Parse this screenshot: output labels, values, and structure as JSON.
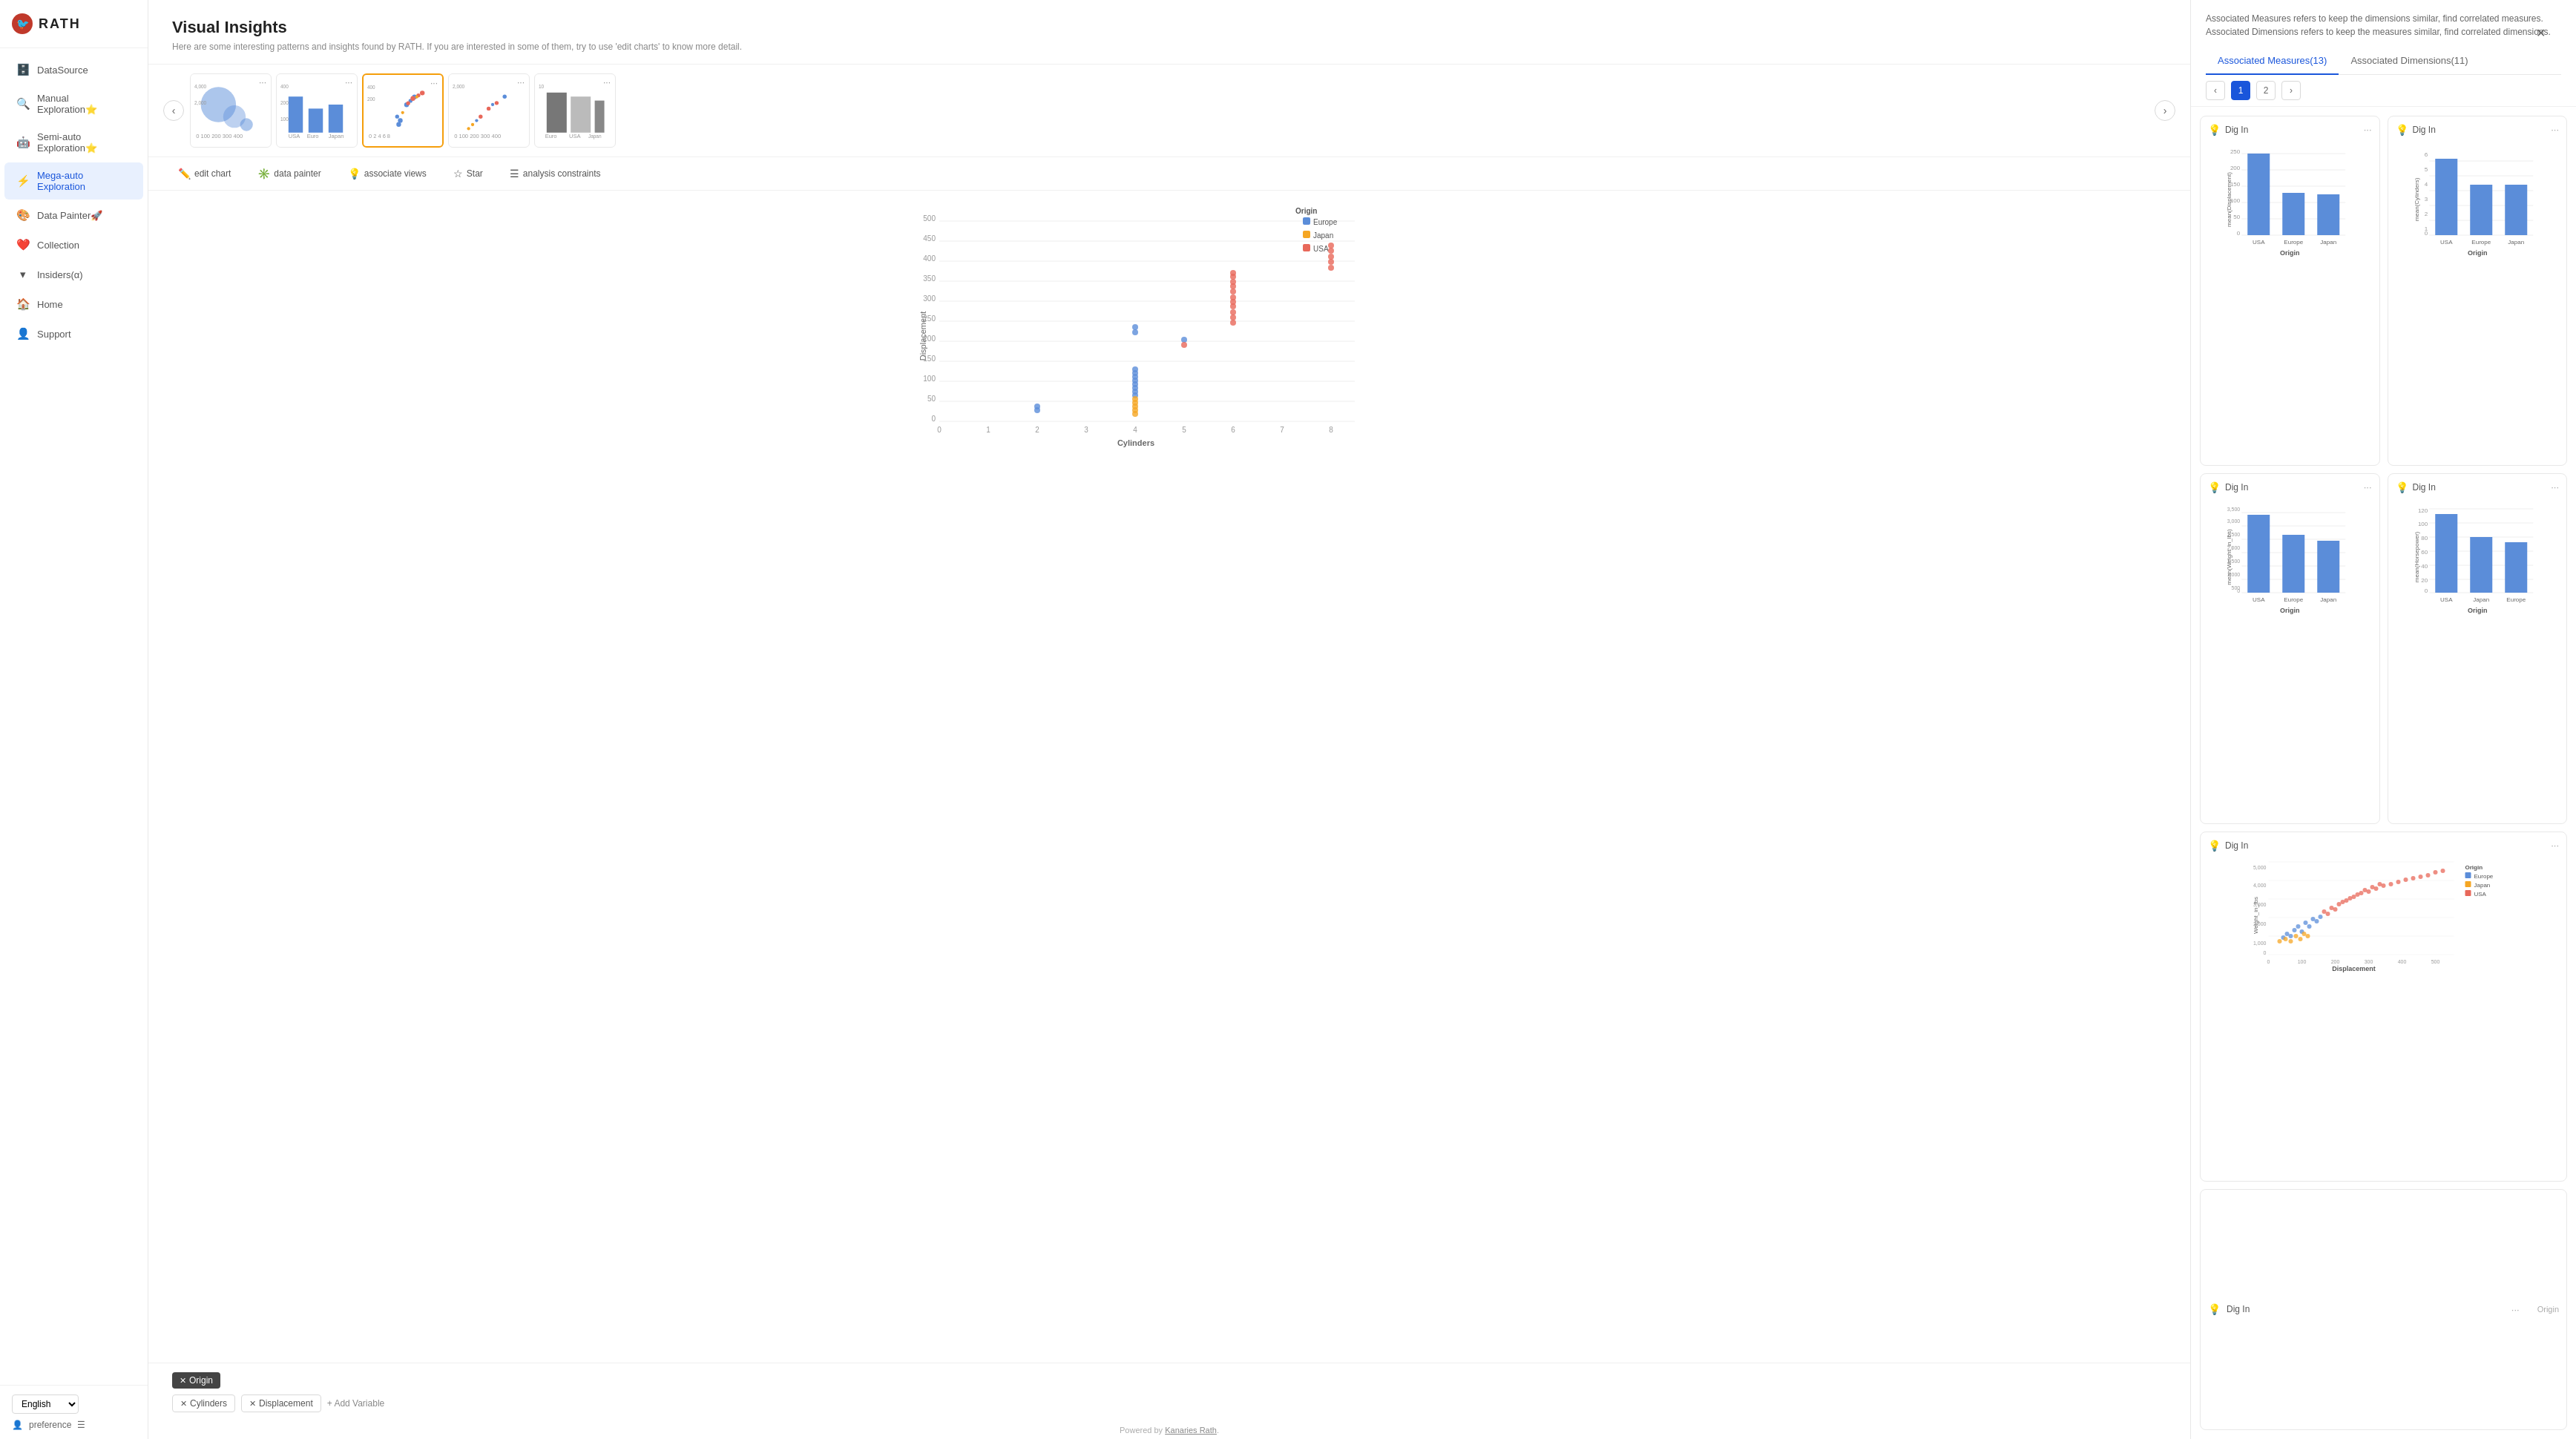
{
  "app": {
    "name": "RATH",
    "logo_emoji": "🐦"
  },
  "sidebar": {
    "items": [
      {
        "id": "datasource",
        "label": "DataSource",
        "icon": "🗄️",
        "active": false
      },
      {
        "id": "manual",
        "label": "Manual Exploration⭐",
        "icon": "🔍",
        "active": false
      },
      {
        "id": "semiauto",
        "label": "Semi-auto Exploration⭐",
        "icon": "🤖",
        "active": false
      },
      {
        "id": "megaauto",
        "label": "Mega-auto Exploration",
        "icon": "⚡",
        "active": true
      },
      {
        "id": "datapainter",
        "label": "Data Painter🚀",
        "icon": "🎨",
        "active": false
      },
      {
        "id": "collection",
        "label": "Collection",
        "icon": "❤️",
        "active": false
      },
      {
        "id": "insiders",
        "label": "Insiders(α)",
        "icon": "▾",
        "active": false
      },
      {
        "id": "home",
        "label": "Home",
        "icon": "🏠",
        "active": false
      },
      {
        "id": "support",
        "label": "Support",
        "icon": "👤",
        "active": false
      }
    ],
    "bottom": {
      "language": "English",
      "preference_label": "preference"
    }
  },
  "main": {
    "title": "Visual Insights",
    "subtitle": "Here are some interesting patterns and insights found by RATH. If you are interested in some of them, try to use 'edit charts' to know more detail.",
    "toolbar": {
      "edit_chart": "edit chart",
      "data_painter": "data painter",
      "associate_views": "associate views",
      "star": "Star",
      "analysis_constraints": "analysis constraints"
    },
    "chart": {
      "x_label": "Cylinders",
      "y_label": "Displacement",
      "legend_title": "Origin",
      "legend_items": [
        "Europe",
        "Japan",
        "USA"
      ],
      "x_ticks": [
        "0",
        "1",
        "2",
        "3",
        "4",
        "5",
        "6",
        "7",
        "8"
      ],
      "y_ticks": [
        "0",
        "50",
        "100",
        "150",
        "200",
        "250",
        "300",
        "350",
        "400",
        "450",
        "500"
      ]
    },
    "variables": {
      "row1": [
        {
          "label": "Origin",
          "removable": true
        }
      ],
      "row2": [
        {
          "label": "Cylinders",
          "removable": true
        },
        {
          "label": "Displacement",
          "removable": true
        }
      ],
      "add_variable": "+ Add Variable"
    },
    "footer": {
      "text": "Powered by ",
      "link_text": "Kanaries Rath",
      "link_url": "#"
    }
  },
  "right_panel": {
    "description": "Associated Measures refers to keep the dimensions similar, find correlated measures. Associated Dimensions refers to keep the measures similar, find correlated dimensions.",
    "tabs": [
      {
        "label": "Associated Measures(13)",
        "active": true
      },
      {
        "label": "Associated Dimensions(11)",
        "active": false
      }
    ],
    "pagination": {
      "current": 1,
      "total": 2
    },
    "cards": [
      {
        "id": 1,
        "label": "Dig In",
        "type": "bar",
        "x_axis": "Origin",
        "y_axis": "mean(Displacement)",
        "data": [
          {
            "label": "USA",
            "value": 250
          },
          {
            "label": "Europe",
            "value": 105
          },
          {
            "label": "Japan",
            "value": 100
          }
        ],
        "y_max": 250,
        "y_ticks": [
          "0",
          "50",
          "100",
          "150",
          "200",
          "250"
        ]
      },
      {
        "id": 2,
        "label": "Dig In",
        "type": "bar",
        "x_axis": "Origin",
        "y_axis": "mean(Cylinders)",
        "data": [
          {
            "label": "USA",
            "value": 6.2
          },
          {
            "label": "Europe",
            "value": 4
          },
          {
            "label": "Japan",
            "value": 4
          }
        ],
        "y_max": 7,
        "y_ticks": [
          "0",
          "1",
          "2",
          "3",
          "4",
          "5",
          "6"
        ]
      },
      {
        "id": 3,
        "label": "Dig In",
        "type": "bar",
        "x_axis": "Origin",
        "y_axis": "mean(Weight_in_lbs)",
        "data": [
          {
            "label": "USA",
            "value": 3200
          },
          {
            "label": "Europe",
            "value": 2400
          },
          {
            "label": "Japan",
            "value": 2100
          }
        ],
        "y_max": 3500,
        "y_ticks": [
          "0",
          "500",
          "1,000",
          "1,500",
          "2,000",
          "2,500",
          "3,000",
          "3,500"
        ]
      },
      {
        "id": 4,
        "label": "Dig In",
        "type": "bar",
        "x_axis": "Origin",
        "y_axis": "mean(Horsepower)",
        "data": [
          {
            "label": "USA",
            "value": 112
          },
          {
            "label": "Japan",
            "value": 80
          },
          {
            "label": "Europe",
            "value": 72
          }
        ],
        "y_max": 120,
        "y_ticks": [
          "0",
          "20",
          "40",
          "60",
          "80",
          "100",
          "120"
        ]
      },
      {
        "id": 5,
        "label": "Dig In",
        "type": "scatter",
        "x_axis": "Displacement",
        "y_axis": "Weight_in_lbs",
        "legend_title": "Origin",
        "legend_items": [
          "Europe",
          "Japan",
          "USA"
        ],
        "x_ticks": [
          "0",
          "100",
          "200",
          "300",
          "400",
          "500"
        ],
        "y_ticks": [
          "0",
          "1,000",
          "2,000",
          "3,000",
          "4,000",
          "5,000"
        ]
      },
      {
        "id": 6,
        "label": "Dig In",
        "type": "placeholder",
        "x_axis": "Origin"
      }
    ]
  }
}
